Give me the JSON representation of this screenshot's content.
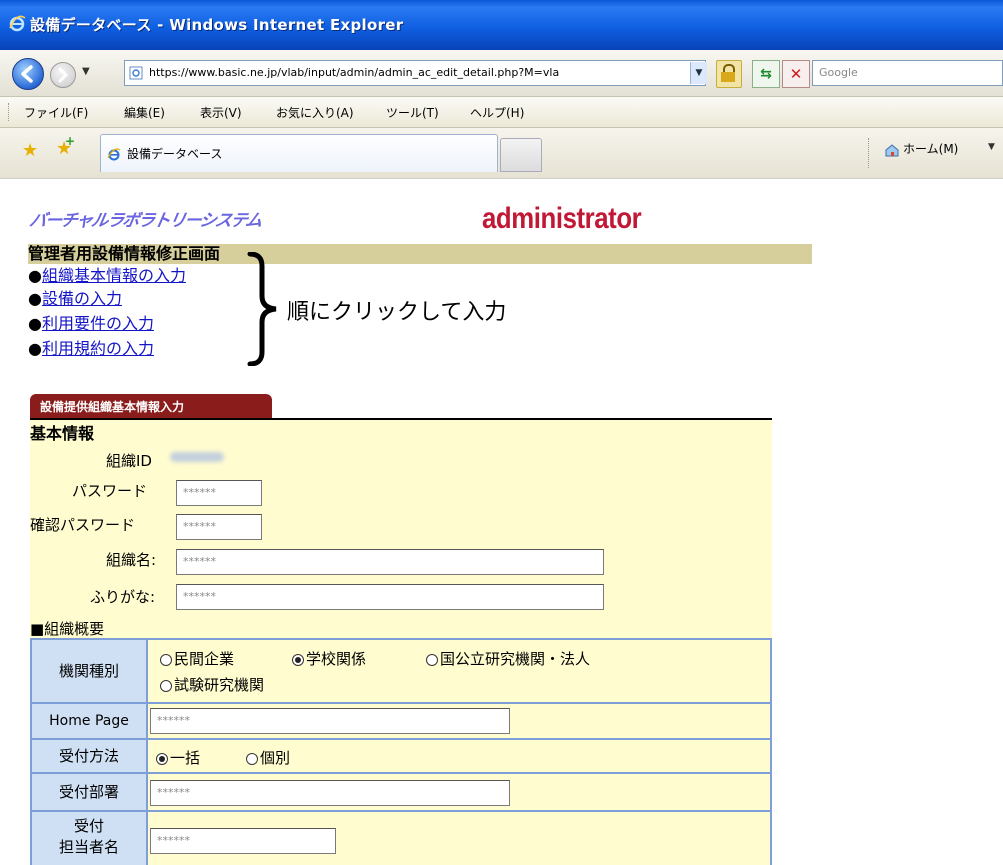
{
  "window": {
    "title": "設備データベース - Windows Internet Explorer"
  },
  "toolbar": {
    "address": "https://www.basic.ne.jp/vlab/input/admin/admin_ac_edit_detail.php?M=vla",
    "search_placeholder": "Google"
  },
  "menu": {
    "items": [
      "ファイル(F)",
      "編集(E)",
      "表示(V)",
      "お気に入り(A)",
      "ツール(T)",
      "ヘルプ(H)"
    ]
  },
  "tabs": {
    "active_label": "設備データベース",
    "home_label": "ホーム(M)"
  },
  "header": {
    "logo_text": "バーチャルラボラトリーシステム",
    "role_label": "administrator",
    "page_title": "管理者用設備情報修正画面"
  },
  "nav_links": [
    {
      "bullet": "●",
      "label": "組織基本情報の入力"
    },
    {
      "bullet": "●",
      "label": "設備の入力"
    },
    {
      "bullet": "●",
      "label": "利用要件の入力"
    },
    {
      "bullet": "●",
      "label": "利用規約の入力"
    }
  ],
  "annotation": "順にクリックして入力",
  "form": {
    "tab_label": "設備提供組織基本情報入力",
    "section_title": "基本情報",
    "org_id_label": "組織ID",
    "password_label": "パスワード",
    "password_value": "******",
    "confirm_password_label": "確認パスワード",
    "confirm_password_value": "******",
    "org_name_label": "組織名:",
    "org_name_value": "******",
    "furigana_label": "ふりがな:",
    "furigana_value": "******",
    "overview_title": "■組織概要",
    "org_type": {
      "label": "機関種別",
      "options": [
        "民間企業",
        "学校関係",
        "国公立研究機関・法人",
        "試験研究機関"
      ],
      "selected": "学校関係"
    },
    "homepage": {
      "label": "Home Page",
      "value": "******"
    },
    "reception_method": {
      "label": "受付方法",
      "options": [
        "一括",
        "個別"
      ],
      "selected": "一括"
    },
    "reception_dept": {
      "label": "受付部署",
      "value": "******"
    },
    "contact_person": {
      "label": "受付担当者名",
      "label_line1": "受付",
      "label_line2": "担当者名",
      "value": "******"
    }
  },
  "colors": {
    "title_bar": "#0f5fe2",
    "admin_red": "#c01835",
    "title_band": "#d6cf9c",
    "form_bg": "#fffcd0",
    "tab_red": "#8a1c1c",
    "table_border": "#7d9ed6",
    "label_bg": "#cfe0f4",
    "link_blue": "#1515c8"
  }
}
